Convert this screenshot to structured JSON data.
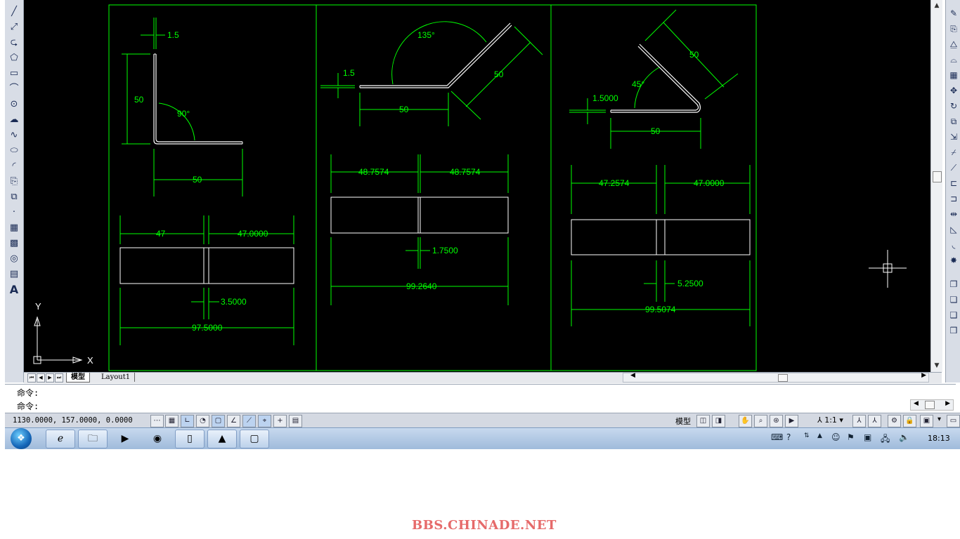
{
  "drawing": {
    "panel1": {
      "thickness": "1.5",
      "leg_height": "50",
      "angle": "90°",
      "leg_width": "50",
      "flat_left": "47",
      "flat_right": "47.0000",
      "gap": "3.5000",
      "total": "97.5000"
    },
    "panel2": {
      "thickness": "1.5",
      "angle": "135°",
      "incline_length": "50",
      "base_length": "50",
      "flat_left": "48.7574",
      "flat_right": "48.7574",
      "gap": "1.7500",
      "total": "99.2640"
    },
    "panel3": {
      "thickness": "1.5000",
      "angle": "45°",
      "incline_length": "50",
      "base_length": "50",
      "flat_left": "47.2574",
      "flat_right": "47.0000",
      "gap": "5.2500",
      "total": "99.5074"
    },
    "ucs": {
      "y": "Y",
      "x": "X"
    }
  },
  "tabs": {
    "model": "模型",
    "layout1": "Layout1"
  },
  "command": {
    "line1": "命令:",
    "line2": "命令:"
  },
  "status": {
    "coordinates": "1130.0000,  157.0000,  0.0000",
    "model_label": "模型",
    "scale": "1:1"
  },
  "taskbar": {
    "clock": "18:13"
  },
  "watermark": "BBS.CHINADE.NET",
  "colors": {
    "geometry": "#ffffff",
    "dimension": "#00ff00",
    "background": "#000000"
  }
}
